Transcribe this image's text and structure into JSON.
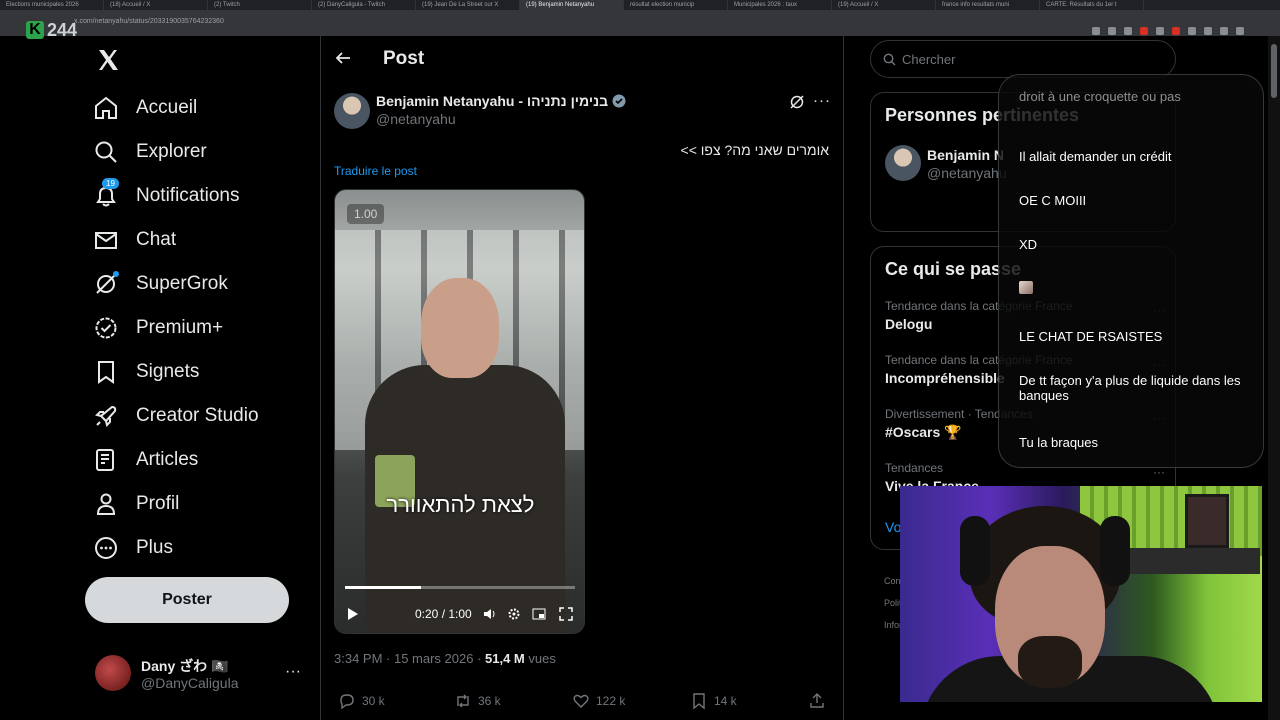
{
  "browser": {
    "tabs": [
      "Elections municipales 2026",
      "(18) Accueil / X",
      "(2) Twitch",
      "(2) DanyCaligula - Twitch",
      "(19) Jean De La Street sur X",
      "(19) Benjamin Netanyahu",
      "résultat election municip",
      "Municipales 2026 : taux",
      "(19) Accueil / X",
      "france info resultats muni",
      "CARTE. Résultats du 1er t"
    ],
    "active_tab_index": 5,
    "url": "x.com/netanyahu/status/2033190035764232360",
    "overlay_logo": "244"
  },
  "nav": {
    "items": [
      {
        "label": "Accueil",
        "icon": "home-icon"
      },
      {
        "label": "Explorer",
        "icon": "search-icon"
      },
      {
        "label": "Notifications",
        "icon": "bell-icon",
        "badge": "19"
      },
      {
        "label": "Chat",
        "icon": "mail-icon"
      },
      {
        "label": "SuperGrok",
        "icon": "grok-icon"
      },
      {
        "label": "Premium+",
        "icon": "verified-icon"
      },
      {
        "label": "Signets",
        "icon": "bookmark-icon"
      },
      {
        "label": "Creator Studio",
        "icon": "rocket-icon"
      },
      {
        "label": "Articles",
        "icon": "article-icon"
      },
      {
        "label": "Profil",
        "icon": "person-icon"
      },
      {
        "label": "Plus",
        "icon": "more-circle-icon"
      }
    ],
    "post_button": "Poster",
    "account": {
      "name": "Dany ざわ 🏴‍☠️",
      "handle": "@DanyCaligula"
    }
  },
  "post": {
    "header_title": "Post",
    "author_name": "Benjamin Netanyahu - בנימין נתניהו",
    "author_handle": "@netanyahu",
    "text": "אומרים שאני מה? צפו >>",
    "translate": "Traduire le post",
    "video": {
      "badge": "1.00",
      "caption": "לצאת להתאוורר",
      "time": "0:20 / 1:00",
      "progress": 0.33
    },
    "meta_time": "3:34 PM · 15 mars 2026 · ",
    "meta_views": "51,4 M",
    "meta_views_label": " vues",
    "actions": {
      "replies": "30 k",
      "reposts": "36 k",
      "likes": "122 k",
      "bookmarks": "14 k"
    }
  },
  "sidebar": {
    "search_placeholder": "Chercher",
    "people_title": "Personnes pertinentes",
    "person_name": "Benjamin N",
    "person_handle": "@netanyahu",
    "trends_title": "Ce qui se passe",
    "trends": [
      {
        "category": "Tendance dans la catégorie France",
        "name": "Delogu"
      },
      {
        "category": "Tendance dans la catégorie France",
        "name": "Incompréhensible"
      },
      {
        "category": "Divertissement · Tendances",
        "name": "#Oscars 🏆"
      },
      {
        "category": "Tendances",
        "name": "Vive la France"
      }
    ],
    "see_more": "Voir plus",
    "footer": [
      "Conditions",
      "Politique",
      "Informations"
    ]
  },
  "chat": {
    "messages": [
      "droit à une croquette ou pas",
      "Il allait demander un crédit",
      "OE C MOIII",
      "XD",
      "",
      "LE CHAT DE RSAISTES",
      "De tt façon y'a plus de liquide dans les banques",
      "Tu la braques"
    ]
  },
  "colors": {
    "background": "#000000",
    "accent": "#1d9bf0",
    "post_button": "#d6d9db"
  }
}
